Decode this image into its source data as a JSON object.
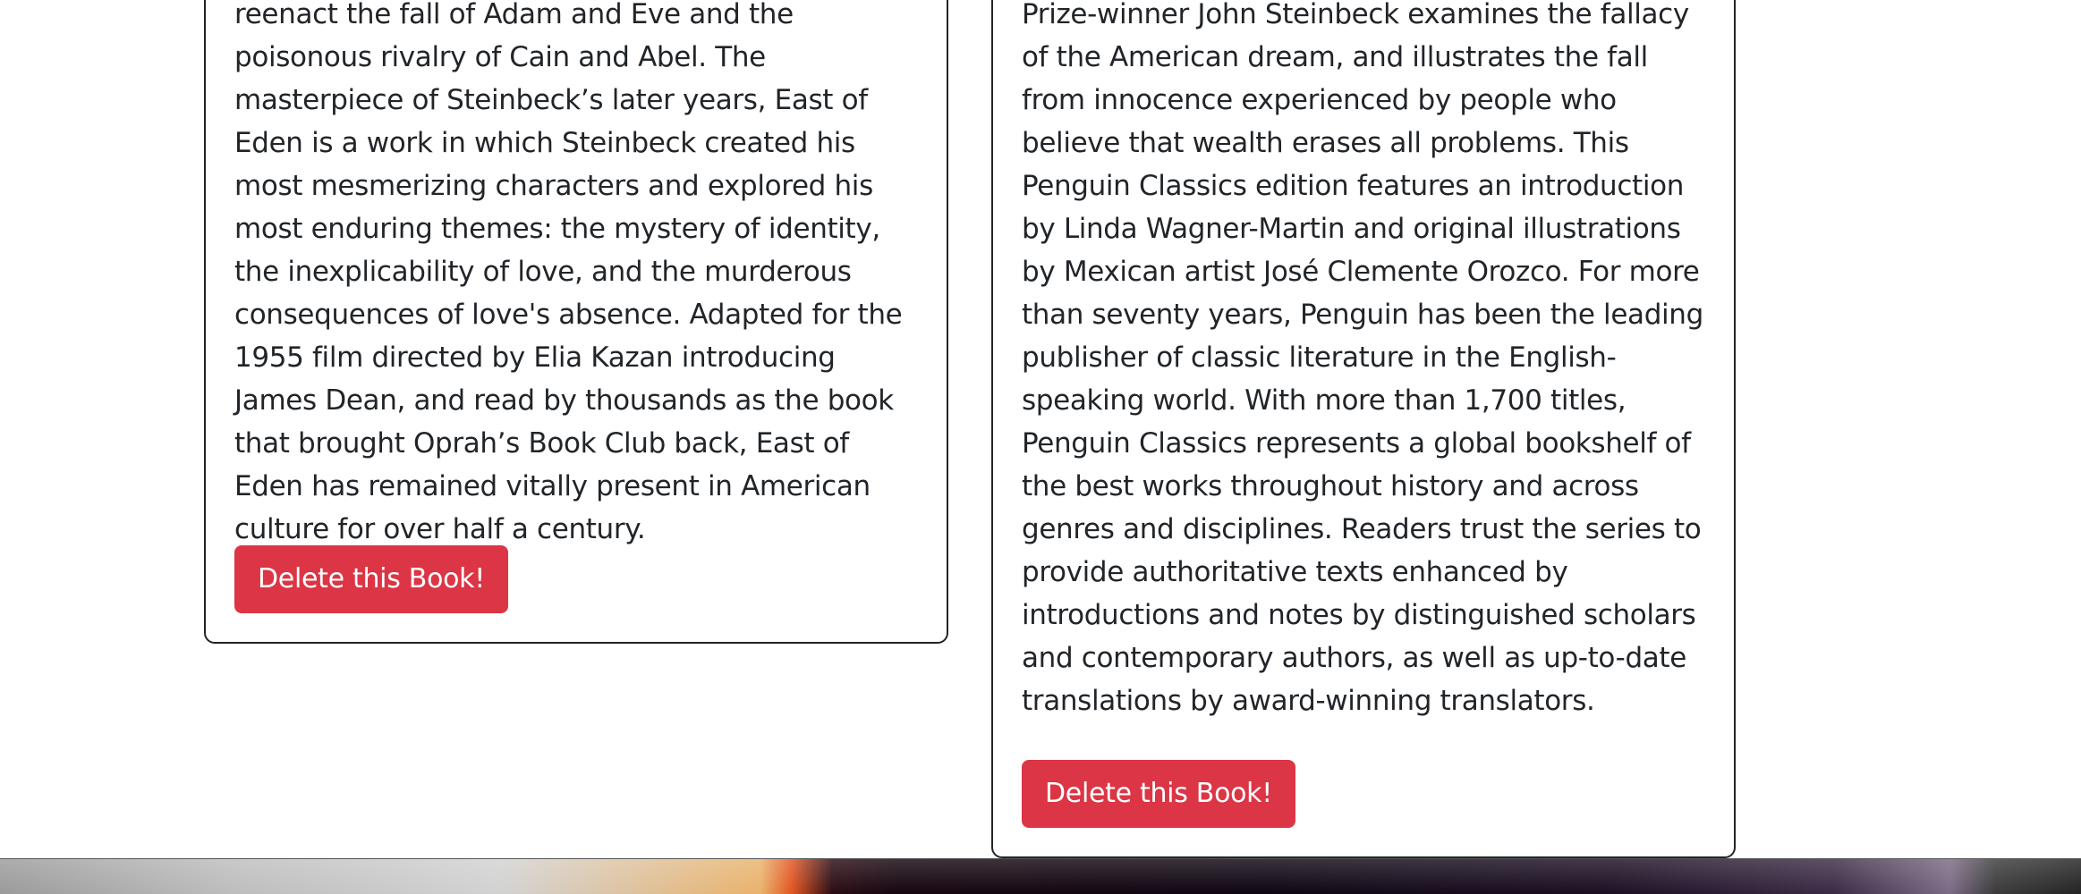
{
  "books": [
    {
      "description": "reenact the fall of Adam and Eve and the poisonous rivalry of Cain and Abel. The masterpiece of Steinbeck’s later years, East of Eden is a work in which Steinbeck created his most mesmerizing characters and explored his most enduring themes: the mystery of identity, the inexplicability of love, and the murderous consequences of love's absence. Adapted for the 1955 film directed by Elia Kazan introducing James Dean, and read by thousands as the book that brought Oprah’s Book Club back, East of Eden has remained vitally present in American culture for over half a century.",
      "delete_label": "Delete this Book!"
    },
    {
      "description": "Prize-winner John Steinbeck examines the fallacy of the American dream, and illustrates the fall from innocence experienced by people who believe that wealth erases all problems. This Penguin Classics edition features an introduction by Linda Wagner-Martin and original illustrations by Mexican artist José Clemente Orozco. For more than seventy years, Penguin has been the leading publisher of classic literature in the English-speaking world. With more than 1,700 titles, Penguin Classics represents a global bookshelf of the best works throughout history and across genres and disciplines. Readers trust the series to provide authoritative texts enhanced by introductions and notes by distinguished scholars and contemporary authors, as well as up-to-date translations by award-winning translators.",
      "delete_label": "Delete this Book!"
    }
  ],
  "colors": {
    "delete_button": "#dc3545",
    "card_border": "#212529",
    "text": "#212529"
  }
}
